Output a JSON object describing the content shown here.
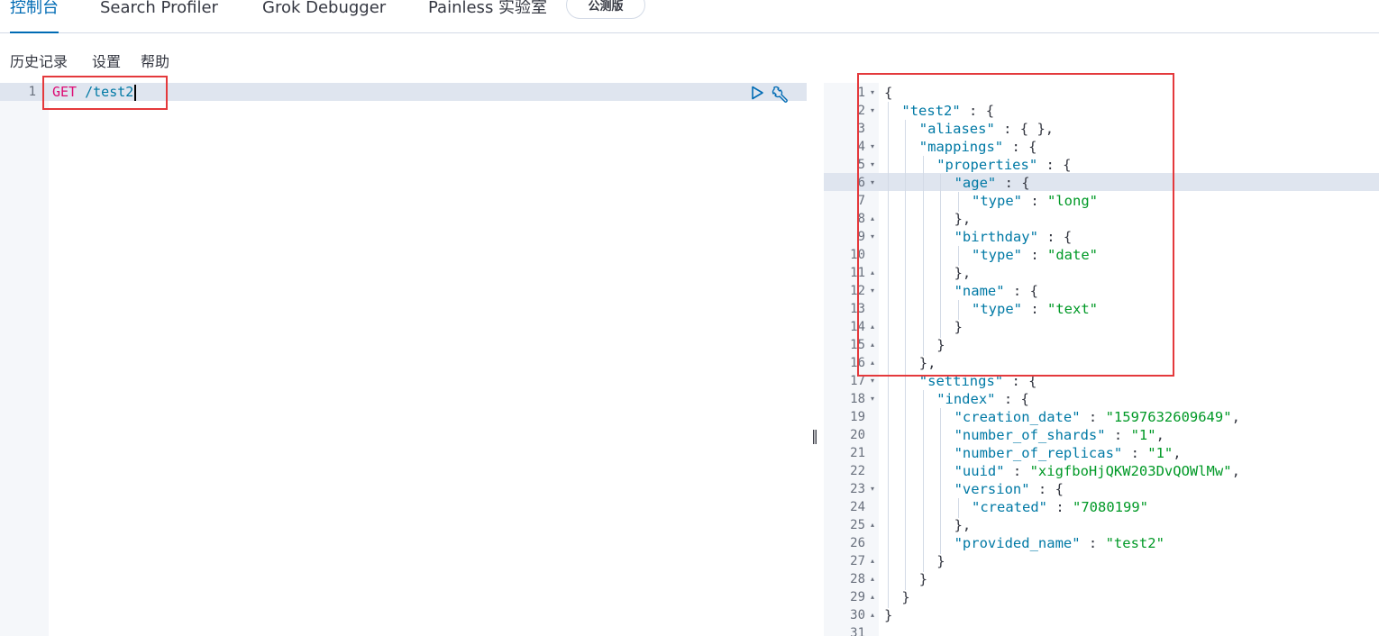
{
  "tabs": [
    "控制台",
    "Search Profiler",
    "Grok Debugger",
    "Painless 实验室"
  ],
  "beta_badge": "公测版",
  "menu": [
    "历史记录",
    "设置",
    "帮助"
  ],
  "request": {
    "line_number": "1",
    "method": "GET",
    "path": "/test2"
  },
  "icons": {
    "send": "play-icon",
    "settings": "wrench-icon",
    "handle": "resize-handle-icon"
  },
  "colors": {
    "accent": "#006bb4",
    "method": "#dd0a73",
    "key": "#0079a5",
    "string": "#009926",
    "highlight": "#e4393c"
  },
  "response_lines": [
    {
      "n": "1",
      "fold": "open",
      "indent": 0,
      "segs": [
        [
          "p",
          "{"
        ]
      ]
    },
    {
      "n": "2",
      "fold": "open",
      "indent": 1,
      "segs": [
        [
          "k",
          "\"test2\""
        ],
        [
          "p",
          " : {"
        ]
      ]
    },
    {
      "n": "3",
      "fold": "",
      "indent": 2,
      "segs": [
        [
          "k",
          "\"aliases\""
        ],
        [
          "p",
          " : { },"
        ]
      ]
    },
    {
      "n": "4",
      "fold": "open",
      "indent": 2,
      "segs": [
        [
          "k",
          "\"mappings\""
        ],
        [
          "p",
          " : {"
        ]
      ]
    },
    {
      "n": "5",
      "fold": "open",
      "indent": 3,
      "segs": [
        [
          "k",
          "\"properties\""
        ],
        [
          "p",
          " : {"
        ]
      ]
    },
    {
      "n": "6",
      "fold": "open",
      "indent": 4,
      "segs": [
        [
          "k",
          "\"age\""
        ],
        [
          "p",
          " : {"
        ]
      ]
    },
    {
      "n": "7",
      "fold": "",
      "indent": 5,
      "segs": [
        [
          "k",
          "\"type\""
        ],
        [
          "p",
          " : "
        ],
        [
          "s",
          "\"long\""
        ]
      ]
    },
    {
      "n": "8",
      "fold": "close",
      "indent": 4,
      "segs": [
        [
          "p",
          "},"
        ]
      ]
    },
    {
      "n": "9",
      "fold": "open",
      "indent": 4,
      "segs": [
        [
          "k",
          "\"birthday\""
        ],
        [
          "p",
          " : {"
        ]
      ]
    },
    {
      "n": "10",
      "fold": "",
      "indent": 5,
      "segs": [
        [
          "k",
          "\"type\""
        ],
        [
          "p",
          " : "
        ],
        [
          "s",
          "\"date\""
        ]
      ]
    },
    {
      "n": "11",
      "fold": "close",
      "indent": 4,
      "segs": [
        [
          "p",
          "},"
        ]
      ]
    },
    {
      "n": "12",
      "fold": "open",
      "indent": 4,
      "segs": [
        [
          "k",
          "\"name\""
        ],
        [
          "p",
          " : {"
        ]
      ]
    },
    {
      "n": "13",
      "fold": "",
      "indent": 5,
      "segs": [
        [
          "k",
          "\"type\""
        ],
        [
          "p",
          " : "
        ],
        [
          "s",
          "\"text\""
        ]
      ]
    },
    {
      "n": "14",
      "fold": "close",
      "indent": 4,
      "segs": [
        [
          "p",
          "}"
        ]
      ]
    },
    {
      "n": "15",
      "fold": "close",
      "indent": 3,
      "segs": [
        [
          "p",
          "}"
        ]
      ]
    },
    {
      "n": "16",
      "fold": "close",
      "indent": 2,
      "segs": [
        [
          "p",
          "},"
        ]
      ]
    },
    {
      "n": "17",
      "fold": "open",
      "indent": 2,
      "segs": [
        [
          "k",
          "\"settings\""
        ],
        [
          "p",
          " : {"
        ]
      ]
    },
    {
      "n": "18",
      "fold": "open",
      "indent": 3,
      "segs": [
        [
          "k",
          "\"index\""
        ],
        [
          "p",
          " : {"
        ]
      ]
    },
    {
      "n": "19",
      "fold": "",
      "indent": 4,
      "segs": [
        [
          "k",
          "\"creation_date\""
        ],
        [
          "p",
          " : "
        ],
        [
          "s",
          "\"1597632609649\""
        ],
        [
          "p",
          ","
        ]
      ]
    },
    {
      "n": "20",
      "fold": "",
      "indent": 4,
      "segs": [
        [
          "k",
          "\"number_of_shards\""
        ],
        [
          "p",
          " : "
        ],
        [
          "s",
          "\"1\""
        ],
        [
          "p",
          ","
        ]
      ]
    },
    {
      "n": "21",
      "fold": "",
      "indent": 4,
      "segs": [
        [
          "k",
          "\"number_of_replicas\""
        ],
        [
          "p",
          " : "
        ],
        [
          "s",
          "\"1\""
        ],
        [
          "p",
          ","
        ]
      ]
    },
    {
      "n": "22",
      "fold": "",
      "indent": 4,
      "segs": [
        [
          "k",
          "\"uuid\""
        ],
        [
          "p",
          " : "
        ],
        [
          "s",
          "\"xigfboHjQKW203DvQOWlMw\""
        ],
        [
          "p",
          ","
        ]
      ]
    },
    {
      "n": "23",
      "fold": "open",
      "indent": 4,
      "segs": [
        [
          "k",
          "\"version\""
        ],
        [
          "p",
          " : {"
        ]
      ]
    },
    {
      "n": "24",
      "fold": "",
      "indent": 5,
      "segs": [
        [
          "k",
          "\"created\""
        ],
        [
          "p",
          " : "
        ],
        [
          "s",
          "\"7080199\""
        ]
      ]
    },
    {
      "n": "25",
      "fold": "close",
      "indent": 4,
      "segs": [
        [
          "p",
          "},"
        ]
      ]
    },
    {
      "n": "26",
      "fold": "",
      "indent": 4,
      "segs": [
        [
          "k",
          "\"provided_name\""
        ],
        [
          "p",
          " : "
        ],
        [
          "s",
          "\"test2\""
        ]
      ]
    },
    {
      "n": "27",
      "fold": "close",
      "indent": 3,
      "segs": [
        [
          "p",
          "}"
        ]
      ]
    },
    {
      "n": "28",
      "fold": "close",
      "indent": 2,
      "segs": [
        [
          "p",
          "}"
        ]
      ]
    },
    {
      "n": "29",
      "fold": "close",
      "indent": 1,
      "segs": [
        [
          "p",
          "}"
        ]
      ]
    },
    {
      "n": "30",
      "fold": "close",
      "indent": 0,
      "segs": [
        [
          "p",
          "}"
        ]
      ]
    },
    {
      "n": "31",
      "fold": "",
      "indent": 0,
      "segs": []
    }
  ]
}
